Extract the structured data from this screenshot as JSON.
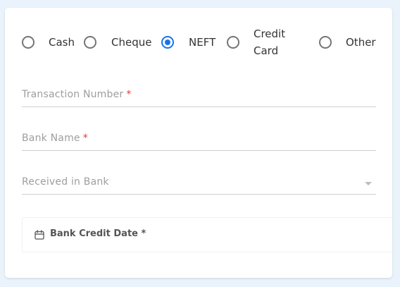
{
  "payment_modes": [
    {
      "label": "Cash",
      "checked": false
    },
    {
      "label": "Cheque",
      "checked": false
    },
    {
      "label": "NEFT",
      "checked": true
    },
    {
      "label_line1": "Credit",
      "label_line2": "Card",
      "checked": false
    },
    {
      "label": "Other",
      "checked": false
    }
  ],
  "fields": {
    "transaction_number": {
      "label": "Transaction Number",
      "required_mark": "*"
    },
    "bank_name": {
      "label": "Bank Name",
      "required_mark": "*"
    },
    "received_in_bank": {
      "label": "Received in Bank"
    }
  },
  "bank_credit_date": {
    "label": "Bank Credit Date *",
    "icon": "calendar-icon"
  },
  "colors": {
    "accent": "#1a73e8",
    "required": "#e53935",
    "background": "#eaf3fc"
  }
}
